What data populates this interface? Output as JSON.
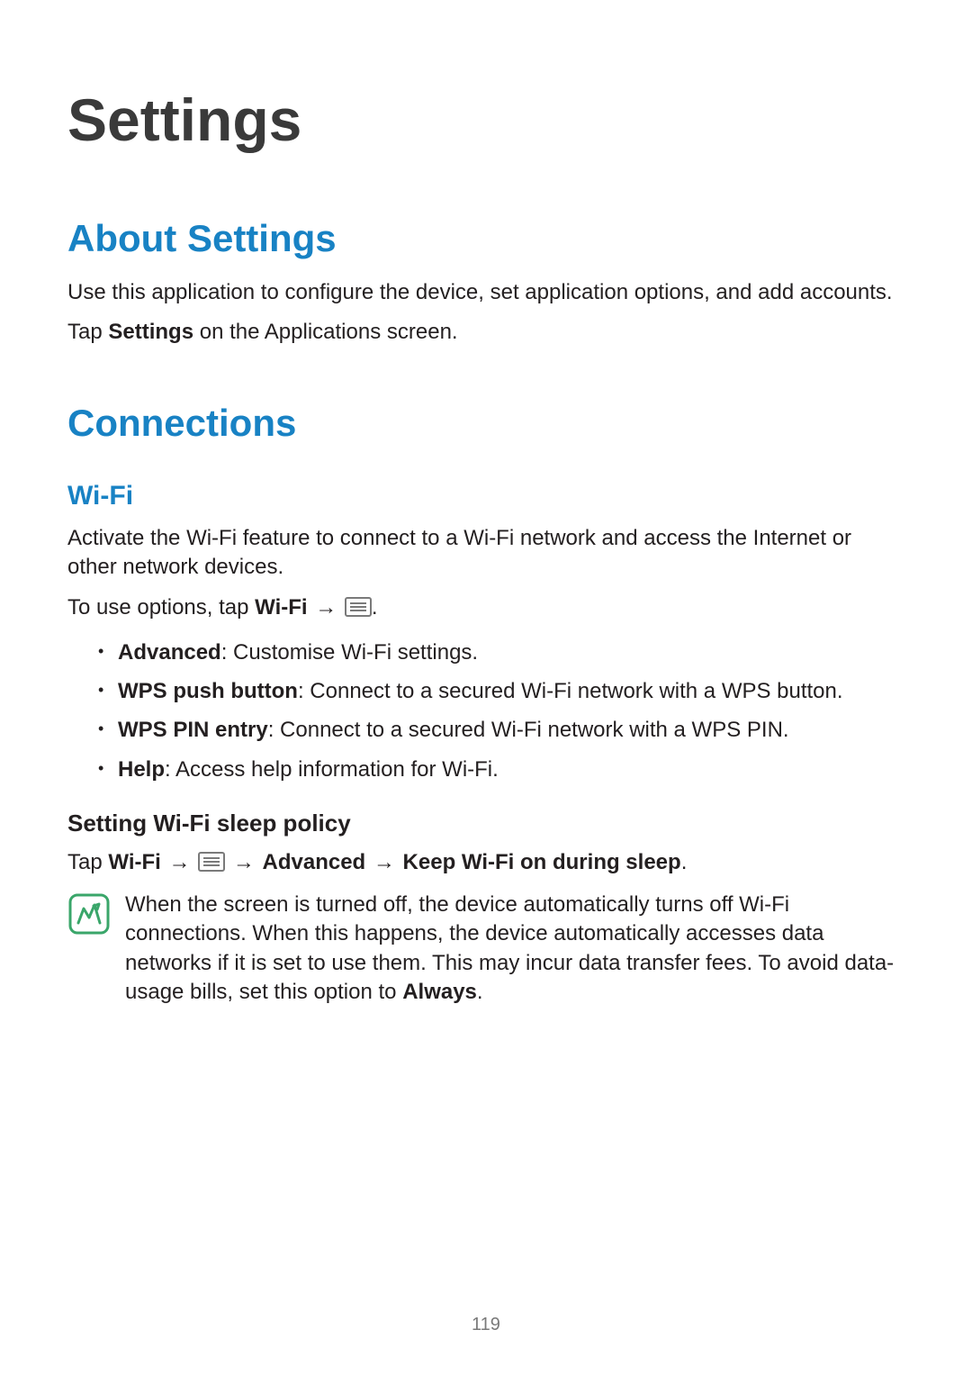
{
  "page_title": "Settings",
  "section_about": {
    "heading": "About Settings",
    "para1": "Use this application to configure the device, set application options, and add accounts.",
    "para2_prefix": "Tap ",
    "para2_bold": "Settings",
    "para2_suffix": " on the Applications screen."
  },
  "section_connections": {
    "heading": "Connections",
    "wifi": {
      "heading": "Wi-Fi",
      "para1": "Activate the Wi-Fi feature to connect to a Wi-Fi network and access the Internet or other network devices.",
      "para2_prefix": "To use options, tap ",
      "para2_bold": "Wi-Fi",
      "arrow": "→",
      "para2_suffix": ".",
      "bullets": [
        {
          "bold": "Advanced",
          "rest": ": Customise Wi-Fi settings."
        },
        {
          "bold": "WPS push button",
          "rest": ": Connect to a secured Wi-Fi network with a WPS button."
        },
        {
          "bold": "WPS PIN entry",
          "rest": ": Connect to a secured Wi-Fi network with a WPS PIN."
        },
        {
          "bold": "Help",
          "rest": ": Access help information for Wi-Fi."
        }
      ],
      "sleep": {
        "heading": "Setting Wi-Fi sleep policy",
        "line_prefix": "Tap ",
        "step1": "Wi-Fi",
        "step2": "Advanced",
        "step3": "Keep Wi-Fi on during sleep",
        "line_suffix": ".",
        "note_text": "When the screen is turned off, the device automatically turns off Wi-Fi connections. When this happens, the device automatically accesses data networks if it is set to use them. This may incur data transfer fees. To avoid data-usage bills, set this option to ",
        "note_bold": "Always",
        "note_suffix": "."
      }
    }
  },
  "page_number": "119"
}
